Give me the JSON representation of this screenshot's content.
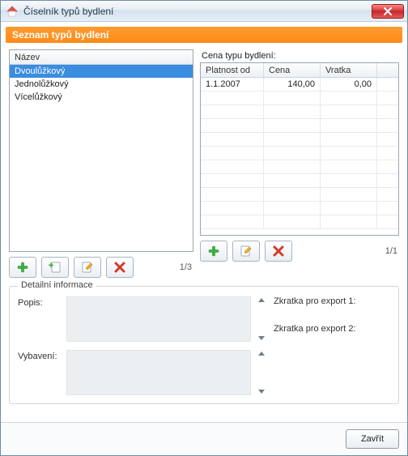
{
  "window": {
    "title": "Číselník typů bydlení"
  },
  "header": {
    "title": "Seznam typů bydlení"
  },
  "list": {
    "column": "Název",
    "items": [
      {
        "label": "Dvoulůžkový",
        "selected": true
      },
      {
        "label": "Jednolůžkový",
        "selected": false
      },
      {
        "label": "Vícelůžkový",
        "selected": false
      }
    ],
    "pager": "1/3"
  },
  "price": {
    "label": "Cena typu bydlení:",
    "columns": {
      "c1": "Platnost od",
      "c2": "Cena",
      "c3": "Vratka"
    },
    "rows": [
      {
        "platnost": "1.1.2007",
        "cena": "140,00",
        "vratka": "0,00"
      }
    ],
    "pager": "1/1"
  },
  "detail": {
    "legend": "Detailní informace",
    "popis_label": "Popis:",
    "vybaveni_label": "Vybavení:",
    "abbr1_label": "Zkratka pro export 1:",
    "abbr2_label": "Zkratka pro export 2:"
  },
  "footer": {
    "close": "Zavřít"
  },
  "icons": {
    "plus": "plus-icon",
    "plus_page": "new-page-icon",
    "edit": "edit-icon",
    "delete": "delete-icon"
  }
}
